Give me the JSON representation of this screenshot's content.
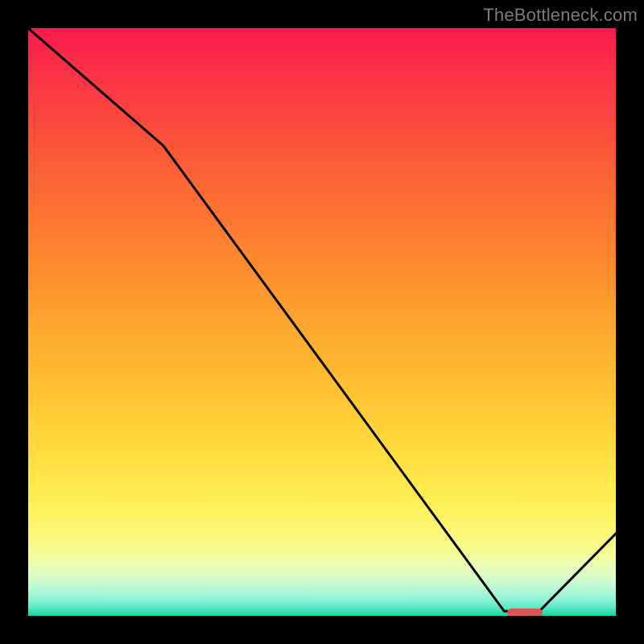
{
  "watermark": "TheBottleneck.com",
  "chart_data": {
    "type": "line",
    "x": [
      0.0,
      0.23,
      0.81,
      0.87,
      1.0
    ],
    "values": [
      1.0,
      0.8,
      0.008,
      0.008,
      0.14
    ],
    "xlim": [
      0,
      1
    ],
    "ylim": [
      0,
      1
    ],
    "title": "",
    "xlabel": "",
    "ylabel": "",
    "line_color": "#000000",
    "line_width": 3,
    "background": "gradient-bottleneck",
    "marker": {
      "x0": 0.815,
      "x1": 0.875,
      "y": 0.006,
      "color": "#d95454"
    }
  }
}
